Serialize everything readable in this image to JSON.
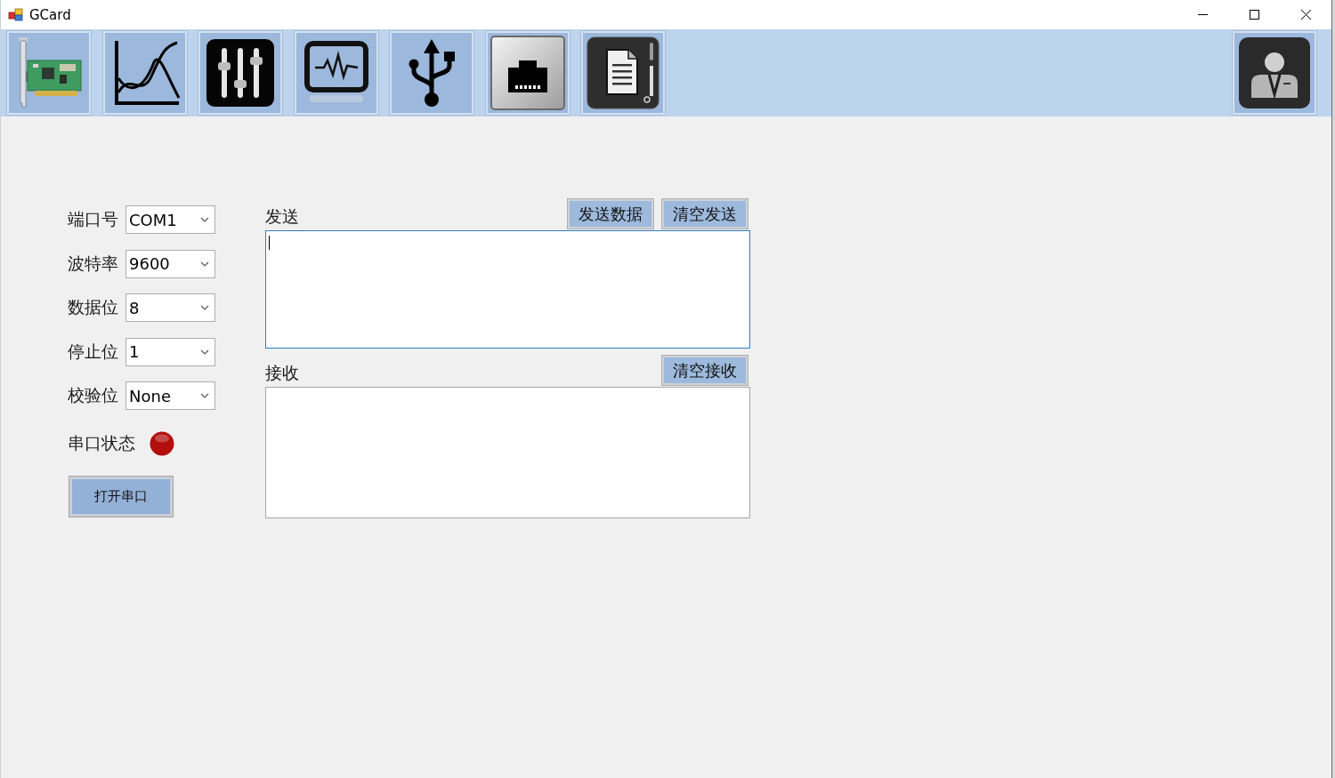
{
  "window": {
    "title": "GCard"
  },
  "toolbar": {
    "left_buttons": [
      {
        "kind": "card"
      },
      {
        "kind": "chart"
      },
      {
        "kind": "mixer"
      },
      {
        "kind": "monitor"
      },
      {
        "kind": "usb"
      },
      {
        "kind": "ethernet"
      },
      {
        "kind": "document"
      }
    ],
    "right_buttons": [
      {
        "kind": "user"
      }
    ]
  },
  "serial_settings": [
    {
      "label": "端口号",
      "value": "COM1"
    },
    {
      "label": "波特率",
      "value": "9600"
    },
    {
      "label": "数据位",
      "value": "8"
    },
    {
      "label": "停止位",
      "value": "1"
    },
    {
      "label": "校验位",
      "value": "None"
    }
  ],
  "port_status": {
    "label": "串口状态",
    "open": false
  },
  "open_port_button": {
    "label": "打开串口"
  },
  "send": {
    "label": "发送",
    "buttons": [
      "发送数据",
      "清空发送"
    ],
    "focused": true
  },
  "receive": {
    "label": "接收",
    "buttons": [
      "清空接收"
    ],
    "focused": false
  }
}
